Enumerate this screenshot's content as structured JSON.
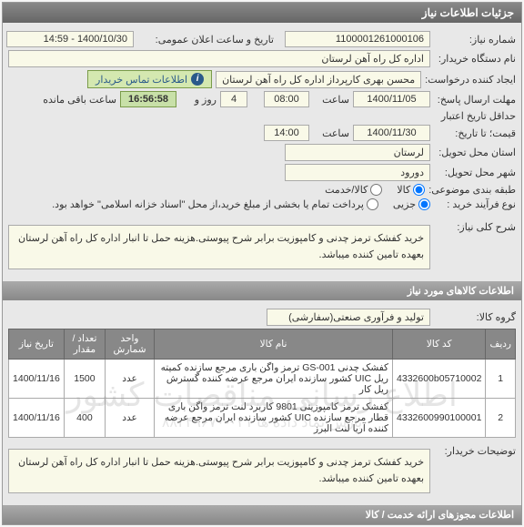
{
  "header": {
    "title": "جزئیات اطلاعات نیاز"
  },
  "info": {
    "need_number_label": "شماره نیاز:",
    "need_number": "1100001261000106",
    "announce_label": "تاریخ و ساعت اعلان عمومی:",
    "announce": "1400/10/30 - 14:59",
    "buyer_label": "نام دستگاه خریدار:",
    "buyer": "اداره کل راه آهن لرستان",
    "creator_label": "ایجاد کننده درخواست:",
    "creator": "محسن بهری کارپرداز اداره کل راه آهن لرستان",
    "contact_link": "اطلاعات تماس خریدار",
    "deadline_label": "مهلت ارسال پاسخ:",
    "deadline_date": "1400/11/05",
    "time_label": "ساعت",
    "deadline_time": "08:00",
    "days_label": "روز و",
    "days": "4",
    "countdown": "16:56:58",
    "remaining_label": "ساعت باقی مانده",
    "validity_from_label": "حداقل تاریخ اعتبار",
    "validity_to_label": "قیمت؛ تا تاریخ:",
    "validity_date": "1400/11/30",
    "validity_time": "14:00",
    "province_label": "استان محل تحویل:",
    "province": "لرستان",
    "city_label": "شهر محل تحویل:",
    "city": "دورود",
    "category_label": "طبقه بندی موضوعی:",
    "cat_goods": "کالا",
    "cat_service": "کالا/خدمت",
    "process_label": "نوع فرآیند خرید :",
    "proc_partial": "جزیی",
    "proc_middle": "پرداخت تمام یا بخشی از مبلغ خرید،از محل \"اسناد خزانه اسلامی\" خواهد بود."
  },
  "need": {
    "desc_label": "شرح کلی نیاز:",
    "desc": "خرید کفشک ترمز چدنی و کامپوزیت برابر شرح پیوستی.هزینه حمل تا انبار اداره کل راه آهن لرستان بعهده تامین کننده میباشد."
  },
  "items_header": "اطلاعات کالاهای مورد نیاز",
  "group": {
    "label": "گروه کالا:",
    "value": "تولید و فرآوری صنعتی(سفارشی)"
  },
  "table": {
    "headers": [
      "ردیف",
      "کد کالا",
      "نام کالا",
      "واحد شمارش",
      "تعداد / مقدار",
      "تاریخ نیاز"
    ],
    "rows": [
      {
        "idx": "1",
        "code": "4332600b05710002",
        "name": "کفشک چدنی GS-001 ترمز واگن باری مرجع سازنده کمیته ریل UIC کشور سازنده ایران مرجع عرضه کننده گسترش ریل کار",
        "unit": "عدد",
        "qty": "1500",
        "date": "1400/11/16"
      },
      {
        "idx": "2",
        "code": "4332600990100001",
        "name": "کفشک ترمز کامپوزیتی 9801 کاربرد لنت ترمز واگن باری قطار مرجع سازنده UIC کشور سازنده ایران مرجع عرضه کننده آریا لنت البرز",
        "unit": "عدد",
        "qty": "400",
        "date": "1400/11/16"
      }
    ]
  },
  "buyer_notes": {
    "label": "توضیحات خریدار:",
    "text": "خرید کفشک ترمز چدنی و کامپوزیت برابر شرح پیوستی.هزینه حمل تا انبار اداره کل راه آهن لرستان بعهده تامین کننده میباشد."
  },
  "footer_header": "اطلاعات مجوزهای ارائه خدمت / کالا",
  "watermark": {
    "line1": "اطلاع رسانی مناقصات کشور",
    "line2": "پارس نماد داده ها ۰۲۱-۸۸۳۴۹۶۷۰"
  }
}
